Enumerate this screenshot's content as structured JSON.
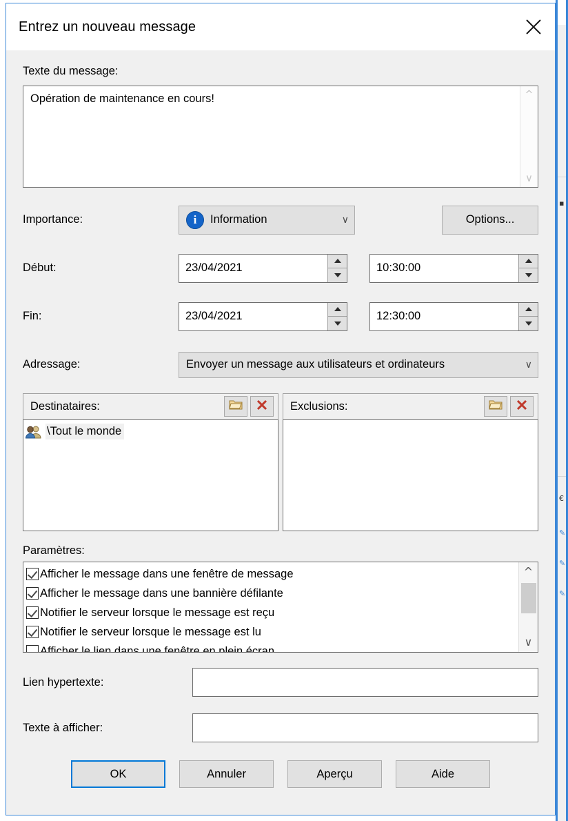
{
  "dialog": {
    "title": "Entrez un nouveau message",
    "close_icon": "close-icon"
  },
  "message": {
    "label": "Texte du message:",
    "value": "Opération de maintenance en cours!",
    "scroll_up_icon": "chevron-up-icon",
    "scroll_down_icon": "chevron-down-icon"
  },
  "importance": {
    "label": "Importance:",
    "value": "Information",
    "icon": "info-icon",
    "icon_glyph": "i",
    "icon_color": "#1464c8",
    "arrow_icon": "chevron-down-icon",
    "options_label": "Options..."
  },
  "debut": {
    "label": "Début:",
    "date": "23/04/2021",
    "time": "10:30:00"
  },
  "fin": {
    "label": "Fin:",
    "date": "23/04/2021",
    "time": "12:30:00"
  },
  "adressage": {
    "label": "Adressage:",
    "value": "Envoyer un message aux utilisateurs et ordinateurs",
    "arrow_icon": "chevron-down-icon"
  },
  "recipients": {
    "label": "Destinataires:",
    "browse_icon": "folder-open-icon",
    "delete_icon": "red-x-icon",
    "items": [
      {
        "text": "\\Tout le monde",
        "icon": "users-group-icon",
        "selected": true
      }
    ]
  },
  "exclusions": {
    "label": "Exclusions:",
    "browse_icon": "folder-open-icon",
    "delete_icon": "red-x-icon",
    "items": []
  },
  "parameters": {
    "label": "Paramètres:",
    "scroll_up_icon": "chevron-up-icon",
    "scroll_down_icon": "chevron-down-icon",
    "items": [
      {
        "label": "Afficher le message dans une fenêtre de message",
        "checked": true
      },
      {
        "label": "Afficher le message dans une bannière défilante",
        "checked": true
      },
      {
        "label": "Notifier le serveur lorsque le message est reçu",
        "checked": true
      },
      {
        "label": "Notifier le serveur lorsque le message est lu",
        "checked": true
      },
      {
        "label": "Afficher le lien dans une fenêtre en plein écran",
        "checked": false
      }
    ]
  },
  "hyperlink": {
    "label": "Lien hypertexte:",
    "value": ""
  },
  "display_text": {
    "label": "Texte à afficher:",
    "value": ""
  },
  "footer": {
    "ok": "OK",
    "cancel": "Annuler",
    "preview": "Aperçu",
    "help": "Aide"
  }
}
